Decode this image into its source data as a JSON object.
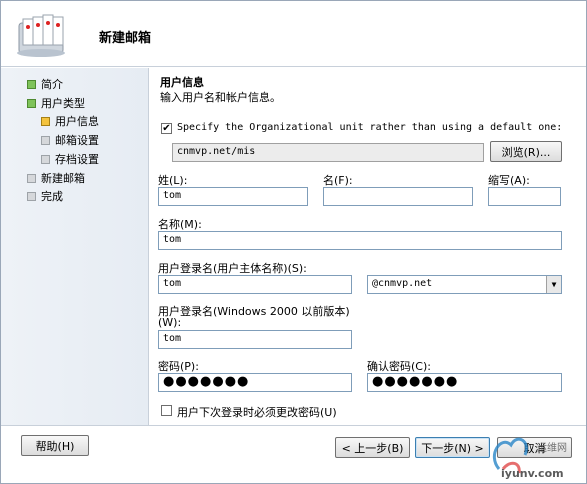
{
  "window": {
    "title": "新建邮箱"
  },
  "steps": [
    {
      "label": "简介",
      "state": "done"
    },
    {
      "label": "用户类型",
      "state": "done"
    },
    {
      "label": "用户信息",
      "state": "current"
    },
    {
      "label": "邮箱设置",
      "state": "pending"
    },
    {
      "label": "存档设置",
      "state": "pending"
    },
    {
      "label": "新建邮箱",
      "state": "pending"
    },
    {
      "label": "完成",
      "state": "pending"
    }
  ],
  "section": {
    "title": "用户信息",
    "description": "输入用户名和帐户信息。"
  },
  "ou": {
    "checked": true,
    "label": "Specify the Organizational unit rather than using a default one:",
    "value": "cnmvp.net/mis",
    "browse_label": "浏览(R)..."
  },
  "fields": {
    "last_name_label": "姓(L):",
    "last_name_value": "tom",
    "first_name_label": "名(F):",
    "first_name_value": "",
    "initials_label": "缩写(A):",
    "initials_value": "",
    "name_label": "名称(M):",
    "name_value": "tom",
    "upn_label": "用户登录名(用户主体名称)(S):",
    "upn_value": "tom",
    "upn_domain": "@cnmvp.net",
    "prewin_label_1": "用户登录名(Windows 2000 以前版本)",
    "prewin_label_2": "(W):",
    "prewin_value": "tom",
    "password_label": "密码(P):",
    "password_value": "●●●●●●●",
    "confirm_label": "确认密码(C):",
    "confirm_value": "●●●●●●●",
    "change_pw_label": "用户下次登录时必须更改密码(U)",
    "change_pw_checked": false
  },
  "buttons": {
    "help": "帮助(H)",
    "back": "< 上一步(B)",
    "next": "下一步(N) >",
    "cancel": "取消"
  },
  "watermark": {
    "text": "iyunv.com",
    "text2": "运维网"
  },
  "colors": {
    "done": "#7fc35a",
    "current": "#f4c33e",
    "pending": "#d6d8db"
  }
}
